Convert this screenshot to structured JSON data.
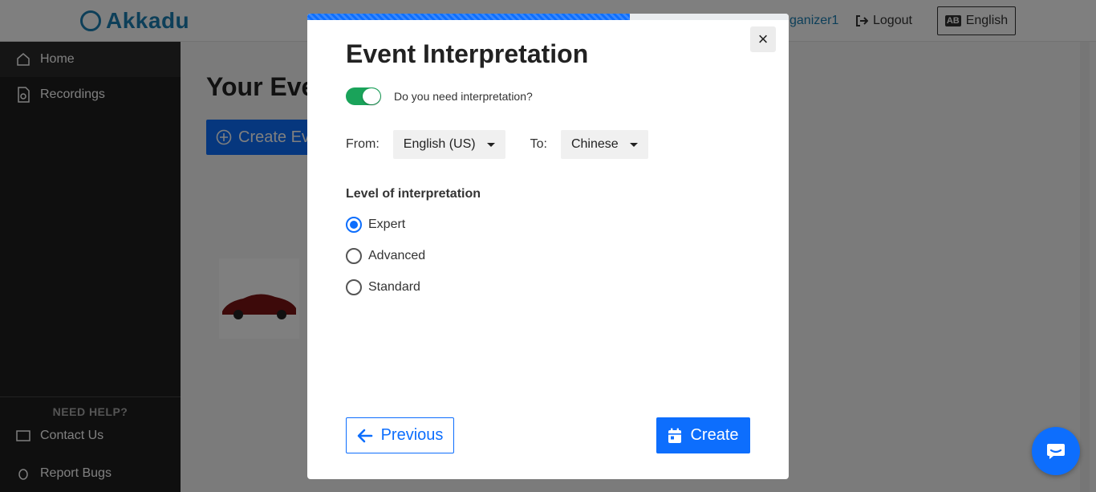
{
  "app": {
    "brand": "Akkadu",
    "user_name": "ganizer1",
    "logout_label": "Logout",
    "language_label": "English",
    "language_glyph": "AB"
  },
  "sidebar": {
    "items": [
      {
        "label": "Home",
        "icon": "home-icon"
      },
      {
        "label": "Recordings",
        "icon": "recordings-icon"
      }
    ],
    "help_title": "NEED HELP?",
    "help_items": [
      {
        "label": "Contact Us",
        "icon": "contact-icon"
      },
      {
        "label": "Report Bugs",
        "icon": "bug-icon"
      }
    ]
  },
  "main": {
    "title": "Your Events",
    "create_button": "Create Event"
  },
  "modal": {
    "progress_percent": 67,
    "close_label": "×",
    "title": "Event Interpretation",
    "toggle_label": "Do you need interpretation?",
    "toggle_on": true,
    "from_label": "From:",
    "from_value": "English (US)",
    "to_label": "To:",
    "to_value": "Chinese",
    "level_title": "Level of interpretation",
    "levels": [
      {
        "label": "Expert",
        "checked": true
      },
      {
        "label": "Advanced",
        "checked": false
      },
      {
        "label": "Standard",
        "checked": false
      }
    ],
    "previous_label": "Previous",
    "create_label": "Create"
  },
  "colors": {
    "primary": "#0d6efd",
    "toggle_on": "#1aa35a",
    "brand": "#1a7fb3"
  }
}
